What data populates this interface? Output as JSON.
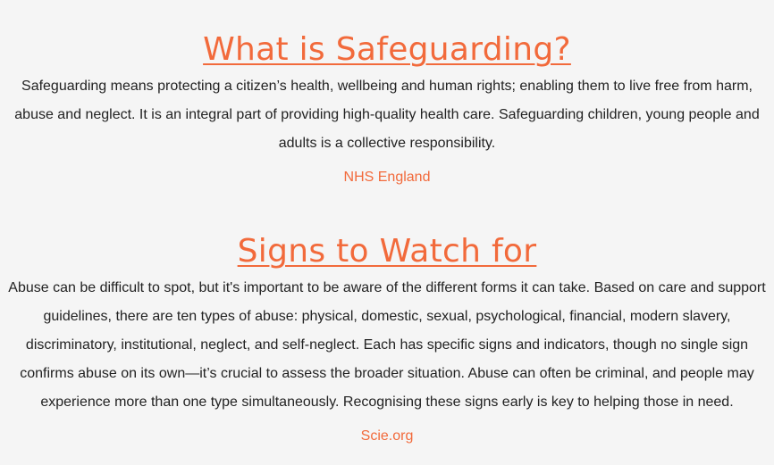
{
  "sections": [
    {
      "heading": "What is Safeguarding?",
      "body": "Safeguarding means protecting a citizen’s health, wellbeing and human rights; enabling them to live free from harm, abuse and neglect. It is an integral part of providing high-quality health care. Safeguarding children, young people and adults is a collective responsibility.",
      "source": "NHS England"
    },
    {
      "heading": "Signs to Watch for",
      "body": "Abuse can be difficult to spot, but it's important to be aware of the different forms it can take. Based on care and support guidelines, there are ten types of abuse: physical, domestic, sexual, psychological, financial, modern slavery, discriminatory, institutional, neglect, and self-neglect. Each has specific signs and indicators, though no single sign confirms abuse on its own—it’s crucial to assess the broader situation. Abuse can often be criminal, and people may experience more than one type simultaneously. Recognising these signs early is key to helping those in need.",
      "source": "Scie.org"
    }
  ],
  "colors": {
    "accent": "#f26a3b",
    "text": "#222222",
    "background": "#f5f5f5"
  }
}
